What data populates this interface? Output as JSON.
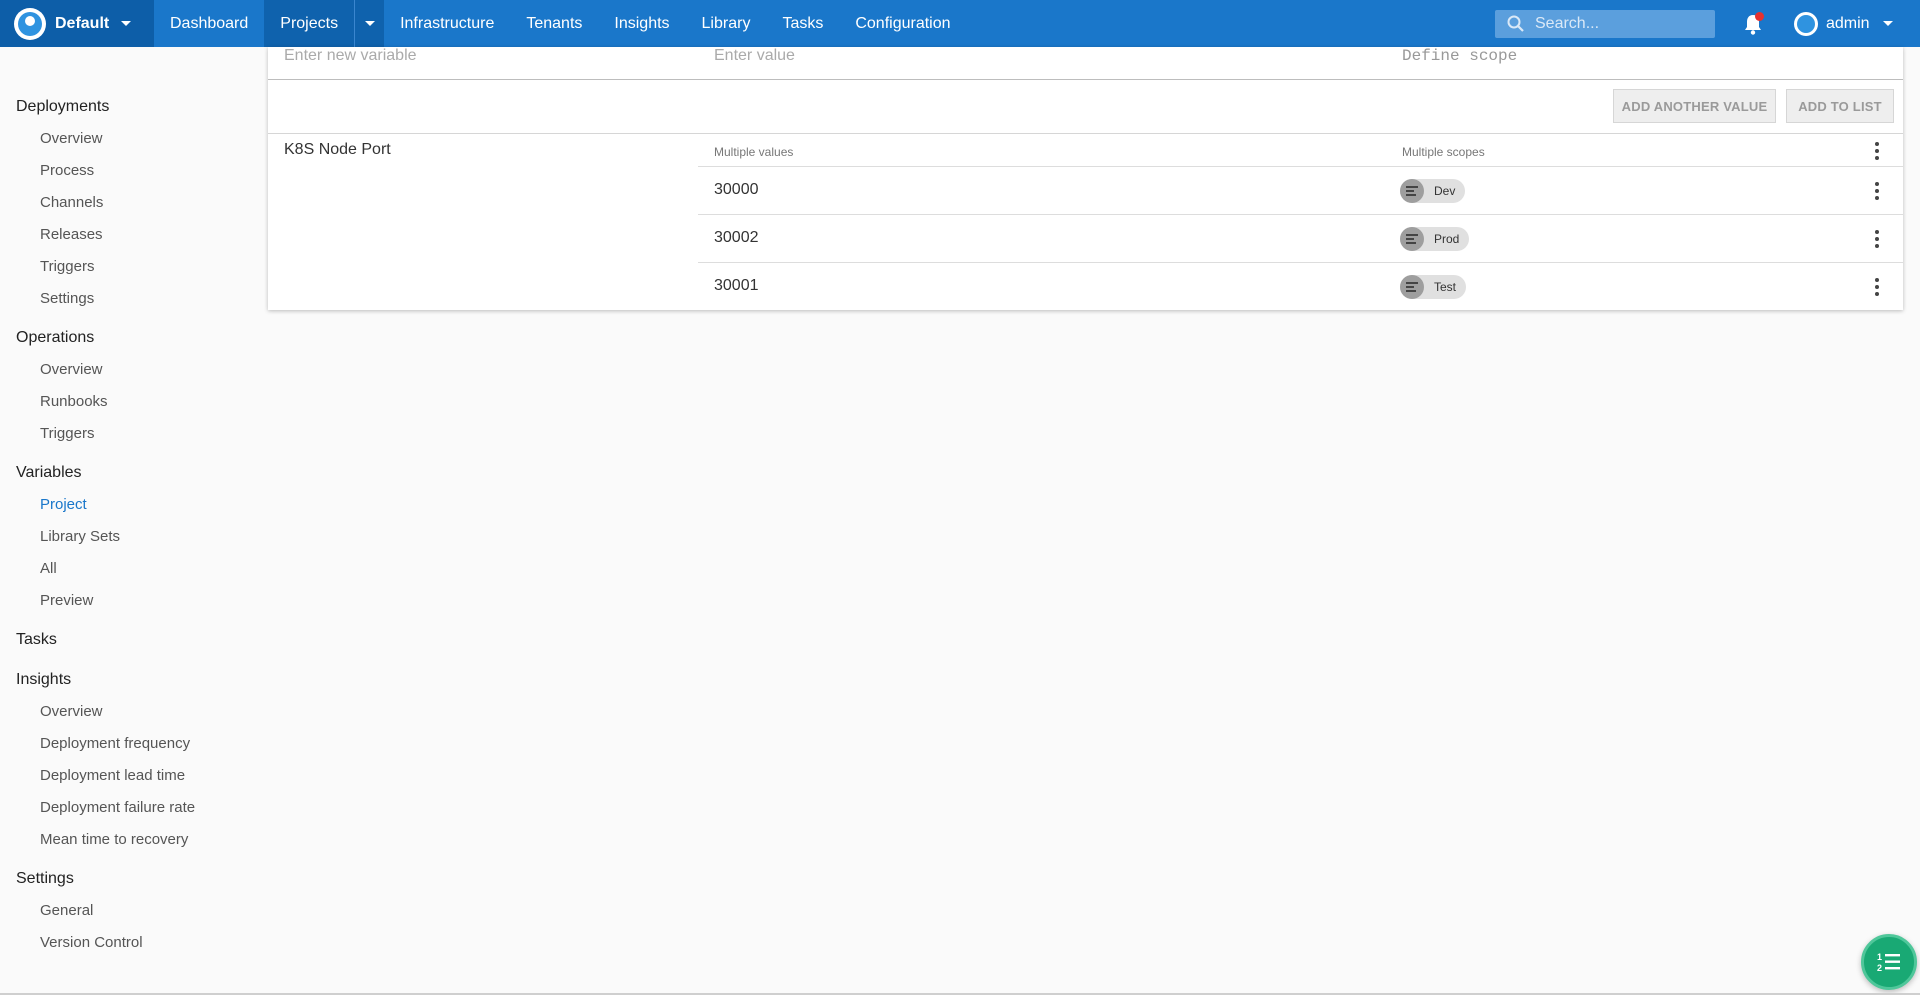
{
  "space": {
    "name": "Default"
  },
  "topnav": {
    "items": [
      "Dashboard",
      "Projects",
      "Infrastructure",
      "Tenants",
      "Insights",
      "Library",
      "Tasks",
      "Configuration"
    ],
    "search_placeholder": "Search...",
    "user": "admin"
  },
  "sidebar": {
    "deployments": {
      "heading": "Deployments",
      "items": [
        "Overview",
        "Process",
        "Channels",
        "Releases",
        "Triggers",
        "Settings"
      ]
    },
    "operations": {
      "heading": "Operations",
      "items": [
        "Overview",
        "Runbooks",
        "Triggers"
      ]
    },
    "variables": {
      "heading": "Variables",
      "items": [
        "Project",
        "Library Sets",
        "All",
        "Preview"
      ],
      "active": "Project"
    },
    "tasks": {
      "heading": "Tasks"
    },
    "insights": {
      "heading": "Insights",
      "items": [
        "Overview",
        "Deployment frequency",
        "Deployment lead time",
        "Deployment failure rate",
        "Mean time to recovery"
      ]
    },
    "settings": {
      "heading": "Settings",
      "items": [
        "General",
        "Version Control"
      ]
    }
  },
  "editor": {
    "name_placeholder": "Enter new variable",
    "value_placeholder": "Enter value",
    "scope_placeholder": "Define scope",
    "add_another_value": "ADD ANOTHER VALUE",
    "add_to_list": "ADD TO LIST"
  },
  "variable": {
    "name": "K8S Node Port",
    "values_header": "Multiple values",
    "scopes_header": "Multiple scopes",
    "rows": [
      {
        "value": "30000",
        "scope": "Dev"
      },
      {
        "value": "30002",
        "scope": "Prod"
      },
      {
        "value": "30001",
        "scope": "Test"
      }
    ]
  },
  "colors": {
    "nav": "#1a77ca",
    "nav_dark": "#0d5ea8",
    "active_link": "#1a77ca",
    "fab": "#19a974"
  }
}
